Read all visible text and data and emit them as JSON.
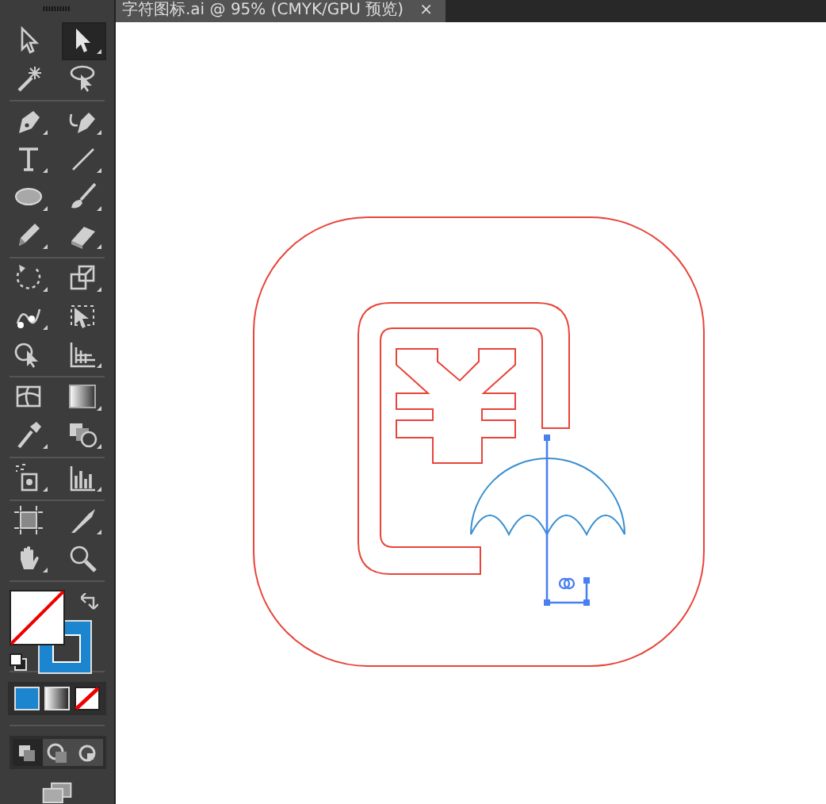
{
  "document_tab": {
    "title": "字符图标.ai @ 95% (CMYK/GPU 预览)",
    "close": "×"
  },
  "tools": [
    {
      "selected": false
    },
    {
      "selected": true
    },
    {
      "selected": false
    },
    {
      "selected": false
    },
    {
      "selected": false
    },
    {
      "selected": false
    },
    {
      "selected": false
    },
    {
      "selected": false
    },
    {
      "selected": false
    },
    {
      "selected": false
    },
    {
      "selected": false
    },
    {
      "selected": false
    },
    {
      "selected": false
    },
    {
      "selected": false
    },
    {
      "selected": false
    },
    {
      "selected": false
    },
    {
      "selected": false
    },
    {
      "selected": false
    },
    {
      "selected": false
    },
    {
      "selected": false
    },
    {
      "selected": false
    },
    {
      "selected": false
    },
    {
      "selected": false
    },
    {
      "selected": false
    },
    {
      "selected": false
    },
    {
      "selected": false
    },
    {
      "selected": false
    },
    {
      "selected": false
    }
  ],
  "drawing_modes": [
    {
      "selected": true
    },
    {
      "selected": false
    },
    {
      "selected": false
    }
  ]
}
